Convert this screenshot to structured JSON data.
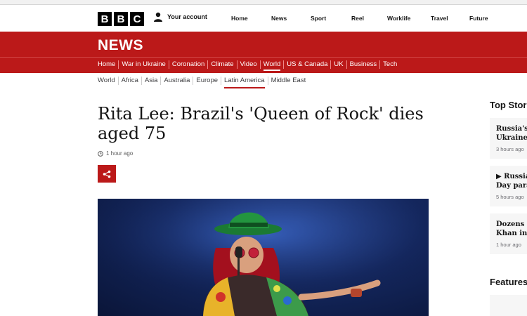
{
  "header": {
    "logo_letters": [
      "B",
      "B",
      "C"
    ],
    "account_label": "Your account",
    "nav": [
      "Home",
      "News",
      "Sport",
      "Reel",
      "Worklife",
      "Travel",
      "Future"
    ]
  },
  "news_banner": {
    "title": "NEWS"
  },
  "section_nav": {
    "items": [
      "Home",
      "War in Ukraine",
      "Coronation",
      "Climate",
      "Video",
      "World",
      "US & Canada",
      "UK",
      "Business",
      "Tech"
    ],
    "active": "World"
  },
  "sub_nav": {
    "items": [
      "World",
      "Africa",
      "Asia",
      "Australia",
      "Europe",
      "Latin America",
      "Middle East"
    ],
    "active": "Latin America"
  },
  "article": {
    "headline": "Rita Lee: Brazil's 'Queen of Rock' dies aged 75",
    "timestamp": "1 hour ago",
    "share_icon": "share-icon",
    "image_alt": "Rita Lee performing with microphone"
  },
  "sidebar": {
    "top_stories_title": "Top Stor",
    "features_title": "Features",
    "stories": [
      {
        "line1": "Russia's",
        "line2": "Ukraine",
        "time": "3 hours ago"
      },
      {
        "line1": "▶ Russia",
        "line2": "Day para",
        "time": "5 hours ago"
      },
      {
        "line1": "Dozens o",
        "line2": "Khan in",
        "time": "1 hour ago"
      }
    ]
  },
  "colors": {
    "brand_red": "#bb1919",
    "text": "#141414"
  }
}
